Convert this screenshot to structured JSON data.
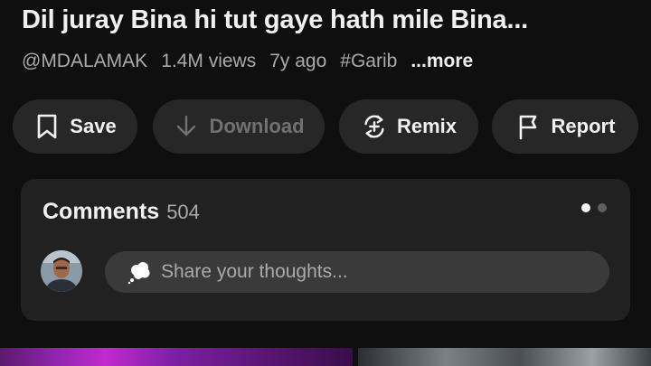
{
  "video": {
    "title": "Dil juray Bina hi tut gaye hath mile Bina...",
    "channel": "@MDALAMAK",
    "views": "1.4M views",
    "age": "7y ago",
    "hashtag": "#Garib",
    "more": "...more"
  },
  "actions": {
    "save": {
      "label": "Save",
      "icon": "bookmark-icon"
    },
    "download": {
      "label": "Download",
      "icon": "download-icon",
      "enabled": false
    },
    "remix": {
      "label": "Remix",
      "icon": "remix-icon"
    },
    "report": {
      "label": "Report",
      "icon": "flag-icon"
    }
  },
  "comments": {
    "title": "Comments",
    "count": "504",
    "input_placeholder": "Share your thoughts...",
    "pager": {
      "pages": 2,
      "active": 1
    }
  },
  "colors": {
    "background": "#0f0f0f",
    "chip": "#272727",
    "panel": "#212121",
    "text": "#f1f1f1",
    "secondary_text": "#aaaaaa"
  }
}
